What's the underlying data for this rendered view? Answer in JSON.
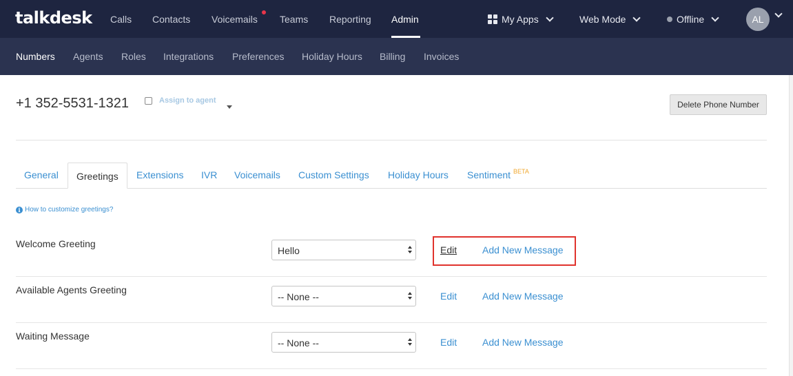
{
  "topnav": {
    "logo": "talkdesk",
    "items": [
      "Calls",
      "Contacts",
      "Voicemails",
      "Teams",
      "Reporting",
      "Admin"
    ],
    "active": "Admin",
    "my_apps": "My Apps",
    "web_mode": "Web Mode",
    "status": "Offline",
    "avatar_initials": "AL"
  },
  "subnav": {
    "items": [
      "Numbers",
      "Agents",
      "Roles",
      "Integrations",
      "Preferences",
      "Holiday Hours",
      "Billing",
      "Invoices"
    ],
    "active": "Numbers"
  },
  "header": {
    "phone_number": "+1 352-5531-1321",
    "assign_label": "Assign to agent",
    "delete_button": "Delete Phone Number"
  },
  "tabs": {
    "items": [
      "General",
      "Greetings",
      "Extensions",
      "IVR",
      "Voicemails",
      "Custom Settings",
      "Holiday Hours",
      "Sentiment"
    ],
    "active": "Greetings",
    "beta_badge": "BETA"
  },
  "help_link": "How to customize greetings?",
  "greetings": [
    {
      "label": "Welcome Greeting",
      "selected": "Hello",
      "edit": "Edit",
      "add": "Add New Message"
    },
    {
      "label": "Available Agents Greeting",
      "selected": "-- None --",
      "edit": "Edit",
      "add": "Add New Message"
    },
    {
      "label": "Waiting Message",
      "selected": "-- None --",
      "edit": "Edit",
      "add": "Add New Message"
    }
  ],
  "colors": {
    "topbar": "#1e2540",
    "subbar": "#2b3350",
    "link": "#3a8fd1",
    "highlight": "#e0322c",
    "beta": "#f0a830"
  }
}
